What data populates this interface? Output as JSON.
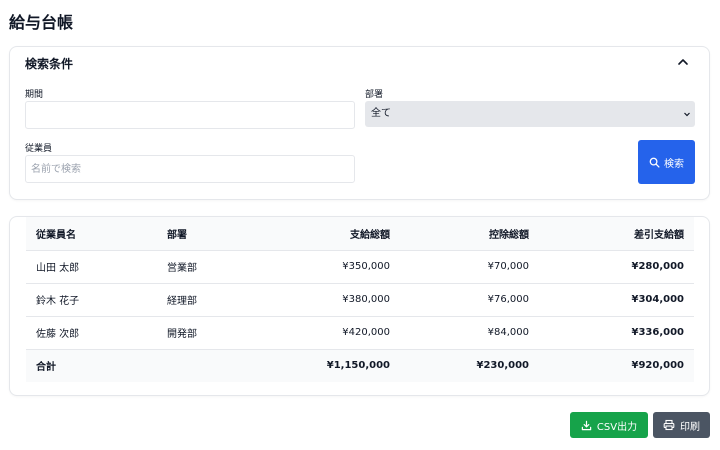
{
  "page": {
    "title": "給与台帳"
  },
  "search": {
    "title": "検索条件",
    "period_label": "期間",
    "period_value": "",
    "department_label": "部署",
    "department_selected": "全て",
    "employee_label": "従業員",
    "employee_placeholder": "名前で検索",
    "search_button": "検索"
  },
  "table": {
    "headers": [
      "従業員名",
      "部署",
      "支給総額",
      "控除総額",
      "差引支給額"
    ],
    "rows": [
      {
        "name": "山田 太郎",
        "department": "営業部",
        "gross": "¥350,000",
        "deduction": "¥70,000",
        "net": "¥280,000"
      },
      {
        "name": "鈴木 花子",
        "department": "経理部",
        "gross": "¥380,000",
        "deduction": "¥76,000",
        "net": "¥304,000"
      },
      {
        "name": "佐藤 次郎",
        "department": "開発部",
        "gross": "¥420,000",
        "deduction": "¥84,000",
        "net": "¥336,000"
      }
    ],
    "total": {
      "label": "合計",
      "gross": "¥1,150,000",
      "deduction": "¥230,000",
      "net": "¥920,000"
    }
  },
  "actions": {
    "csv_label": "CSV出力",
    "print_label": "印刷"
  },
  "colors": {
    "primary": "#2563eb",
    "success": "#16a34a",
    "secondary": "#4b5563"
  }
}
